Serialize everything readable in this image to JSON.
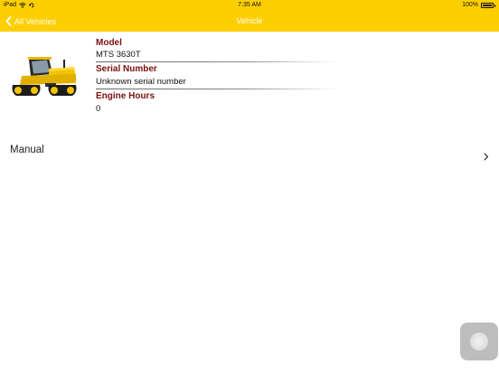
{
  "status_bar": {
    "device": "iPad",
    "time": "7:35 AM",
    "battery": "100%"
  },
  "nav": {
    "back_label": "All Vehicles",
    "title": "Vehicle"
  },
  "vehicle": {
    "image_icon": "tracked-tractor-icon",
    "model_label": "Model",
    "model_value": "MTS 3630T",
    "serial_label": "Serial Number",
    "serial_value": "Unknown serial number",
    "hours_label": "Engine Hours",
    "hours_value": "0"
  },
  "manual_row": {
    "label": "Manual"
  },
  "colors": {
    "accent": "#fdcf00",
    "label": "#7a1010"
  }
}
